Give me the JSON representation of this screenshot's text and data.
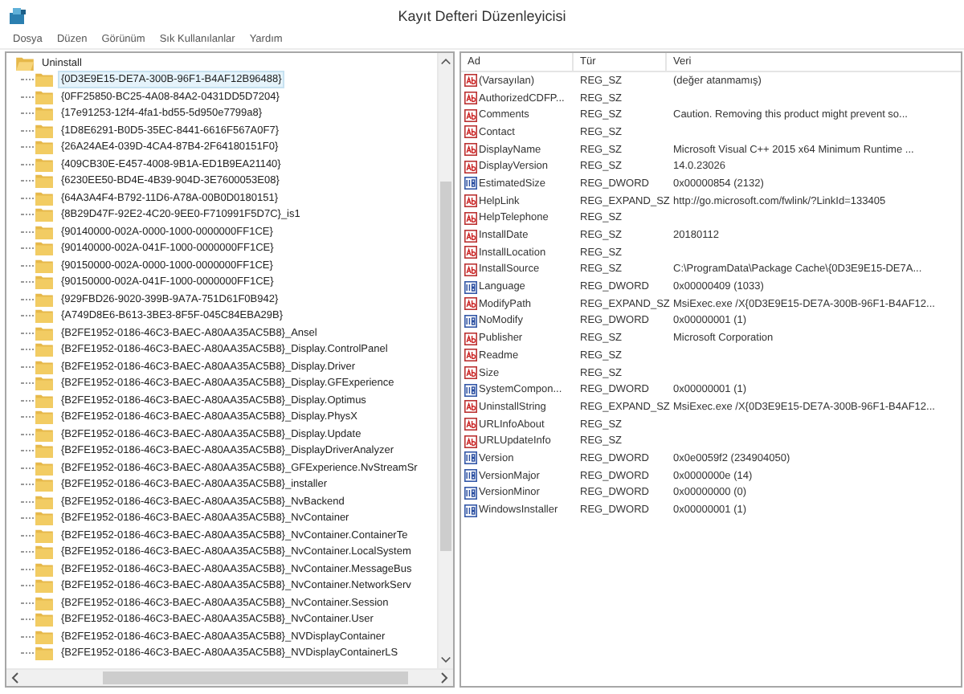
{
  "window": {
    "title": "Kayıt Defteri Düzenleyicisi"
  },
  "menu": [
    "Dosya",
    "Düzen",
    "Görünüm",
    "Sık Kullanılanlar",
    "Yardım"
  ],
  "tree": {
    "label": "Uninstall",
    "expanded": true,
    "children": [
      {
        "label": "{0D3E9E15-DE7A-300B-96F1-B4AF12B96488}",
        "selected": true
      },
      {
        "label": "{0FF25850-BC25-4A08-84A2-0431DD5D7204}",
        "selected": false
      },
      {
        "label": "{17e91253-12f4-4fa1-bd55-5d950e7799a8}",
        "selected": false
      },
      {
        "label": "{1D8E6291-B0D5-35EC-8441-6616F567A0F7}",
        "selected": false
      },
      {
        "label": "{26A24AE4-039D-4CA4-87B4-2F64180151F0}",
        "selected": false
      },
      {
        "label": "{409CB30E-E457-4008-9B1A-ED1B9EA21140}",
        "selected": false
      },
      {
        "label": "{6230EE50-BD4E-4B39-904D-3E7600053E08}",
        "selected": false
      },
      {
        "label": "{64A3A4F4-B792-11D6-A78A-00B0D0180151}",
        "selected": false
      },
      {
        "label": "{8B29D47F-92E2-4C20-9EE0-F710991F5D7C}_is1",
        "selected": false
      },
      {
        "label": "{90140000-002A-0000-1000-0000000FF1CE}",
        "selected": false
      },
      {
        "label": "{90140000-002A-041F-1000-0000000FF1CE}",
        "selected": false
      },
      {
        "label": "{90150000-002A-0000-1000-0000000FF1CE}",
        "selected": false
      },
      {
        "label": "{90150000-002A-041F-1000-0000000FF1CE}",
        "selected": false
      },
      {
        "label": "{929FBD26-9020-399B-9A7A-751D61F0B942}",
        "selected": false
      },
      {
        "label": "{A749D8E6-B613-3BE3-8F5F-045C84EBA29B}",
        "selected": false
      },
      {
        "label": "{B2FE1952-0186-46C3-BAEC-A80AA35AC5B8}_Ansel",
        "selected": false
      },
      {
        "label": "{B2FE1952-0186-46C3-BAEC-A80AA35AC5B8}_Display.ControlPanel",
        "selected": false
      },
      {
        "label": "{B2FE1952-0186-46C3-BAEC-A80AA35AC5B8}_Display.Driver",
        "selected": false
      },
      {
        "label": "{B2FE1952-0186-46C3-BAEC-A80AA35AC5B8}_Display.GFExperience",
        "selected": false
      },
      {
        "label": "{B2FE1952-0186-46C3-BAEC-A80AA35AC5B8}_Display.Optimus",
        "selected": false
      },
      {
        "label": "{B2FE1952-0186-46C3-BAEC-A80AA35AC5B8}_Display.PhysX",
        "selected": false
      },
      {
        "label": "{B2FE1952-0186-46C3-BAEC-A80AA35AC5B8}_Display.Update",
        "selected": false
      },
      {
        "label": "{B2FE1952-0186-46C3-BAEC-A80AA35AC5B8}_DisplayDriverAnalyzer",
        "selected": false
      },
      {
        "label": "{B2FE1952-0186-46C3-BAEC-A80AA35AC5B8}_GFExperience.NvStreamSr",
        "selected": false
      },
      {
        "label": "{B2FE1952-0186-46C3-BAEC-A80AA35AC5B8}_installer",
        "selected": false
      },
      {
        "label": "{B2FE1952-0186-46C3-BAEC-A80AA35AC5B8}_NvBackend",
        "selected": false
      },
      {
        "label": "{B2FE1952-0186-46C3-BAEC-A80AA35AC5B8}_NvContainer",
        "selected": false
      },
      {
        "label": "{B2FE1952-0186-46C3-BAEC-A80AA35AC5B8}_NvContainer.ContainerTe",
        "selected": false
      },
      {
        "label": "{B2FE1952-0186-46C3-BAEC-A80AA35AC5B8}_NvContainer.LocalSystem",
        "selected": false
      },
      {
        "label": "{B2FE1952-0186-46C3-BAEC-A80AA35AC5B8}_NvContainer.MessageBus",
        "selected": false
      },
      {
        "label": "{B2FE1952-0186-46C3-BAEC-A80AA35AC5B8}_NvContainer.NetworkServ",
        "selected": false
      },
      {
        "label": "{B2FE1952-0186-46C3-BAEC-A80AA35AC5B8}_NvContainer.Session",
        "selected": false
      },
      {
        "label": "{B2FE1952-0186-46C3-BAEC-A80AA35AC5B8}_NvContainer.User",
        "selected": false
      },
      {
        "label": "{B2FE1952-0186-46C3-BAEC-A80AA35AC5B8}_NVDisplayContainer",
        "selected": false
      },
      {
        "label": "{B2FE1952-0186-46C3-BAEC-A80AA35AC5B8}_NVDisplayContainerLS",
        "selected": false
      }
    ]
  },
  "values": {
    "columns": [
      "Ad",
      "Tür",
      "Veri"
    ],
    "rows": [
      {
        "kind": "string",
        "name": "(Varsayılan)",
        "type": "REG_SZ",
        "data": "(değer atanmamış)"
      },
      {
        "kind": "string",
        "name": "AuthorizedCDFP...",
        "type": "REG_SZ"
      },
      {
        "kind": "string",
        "name": "Comments",
        "type": "REG_SZ",
        "data": "Caution. Removing this product might prevent so..."
      },
      {
        "kind": "string",
        "name": "Contact",
        "type": "REG_SZ"
      },
      {
        "kind": "string",
        "name": "DisplayName",
        "type": "REG_SZ",
        "data": "Microsoft Visual C++ 2015 x64 Minimum Runtime ..."
      },
      {
        "kind": "string",
        "name": "DisplayVersion",
        "type": "REG_SZ",
        "data": "14.0.23026"
      },
      {
        "kind": "number",
        "name": "EstimatedSize",
        "type": "REG_DWORD",
        "data": "0x00000854 (2132)"
      },
      {
        "kind": "string",
        "name": "HelpLink",
        "type": "REG_EXPAND_SZ",
        "data": "http://go.microsoft.com/fwlink/?LinkId=133405"
      },
      {
        "kind": "string",
        "name": "HelpTelephone",
        "type": "REG_SZ"
      },
      {
        "kind": "string",
        "name": "InstallDate",
        "type": "REG_SZ",
        "data": "20180112"
      },
      {
        "kind": "string",
        "name": "InstallLocation",
        "type": "REG_SZ"
      },
      {
        "kind": "string",
        "name": "InstallSource",
        "type": "REG_SZ",
        "data": "C:\\ProgramData\\Package Cache\\{0D3E9E15-DE7A..."
      },
      {
        "kind": "number",
        "name": "Language",
        "type": "REG_DWORD",
        "data": "0x00000409 (1033)"
      },
      {
        "kind": "string",
        "name": "ModifyPath",
        "type": "REG_EXPAND_SZ",
        "data": "MsiExec.exe /X{0D3E9E15-DE7A-300B-96F1-B4AF12..."
      },
      {
        "kind": "number",
        "name": "NoModify",
        "type": "REG_DWORD",
        "data": "0x00000001 (1)"
      },
      {
        "kind": "string",
        "name": "Publisher",
        "type": "REG_SZ",
        "data": "Microsoft Corporation"
      },
      {
        "kind": "string",
        "name": "Readme",
        "type": "REG_SZ"
      },
      {
        "kind": "string",
        "name": "Size",
        "type": "REG_SZ"
      },
      {
        "kind": "number",
        "name": "SystemCompon...",
        "type": "REG_DWORD",
        "data": "0x00000001 (1)"
      },
      {
        "kind": "string",
        "name": "UninstallString",
        "type": "REG_EXPAND_SZ",
        "data": "MsiExec.exe /X{0D3E9E15-DE7A-300B-96F1-B4AF12..."
      },
      {
        "kind": "string",
        "name": "URLInfoAbout",
        "type": "REG_SZ"
      },
      {
        "kind": "string",
        "name": "URLUpdateInfo",
        "type": "REG_SZ"
      },
      {
        "kind": "number",
        "name": "Version",
        "type": "REG_DWORD",
        "data": "0x0e0059f2 (234904050)"
      },
      {
        "kind": "number",
        "name": "VersionMajor",
        "type": "REG_DWORD",
        "data": "0x0000000e (14)"
      },
      {
        "kind": "number",
        "name": "VersionMinor",
        "type": "REG_DWORD",
        "data": "0x00000000 (0)"
      },
      {
        "kind": "number",
        "name": "WindowsInstaller",
        "type": "REG_DWORD",
        "data": "0x00000001 (1)"
      }
    ]
  }
}
